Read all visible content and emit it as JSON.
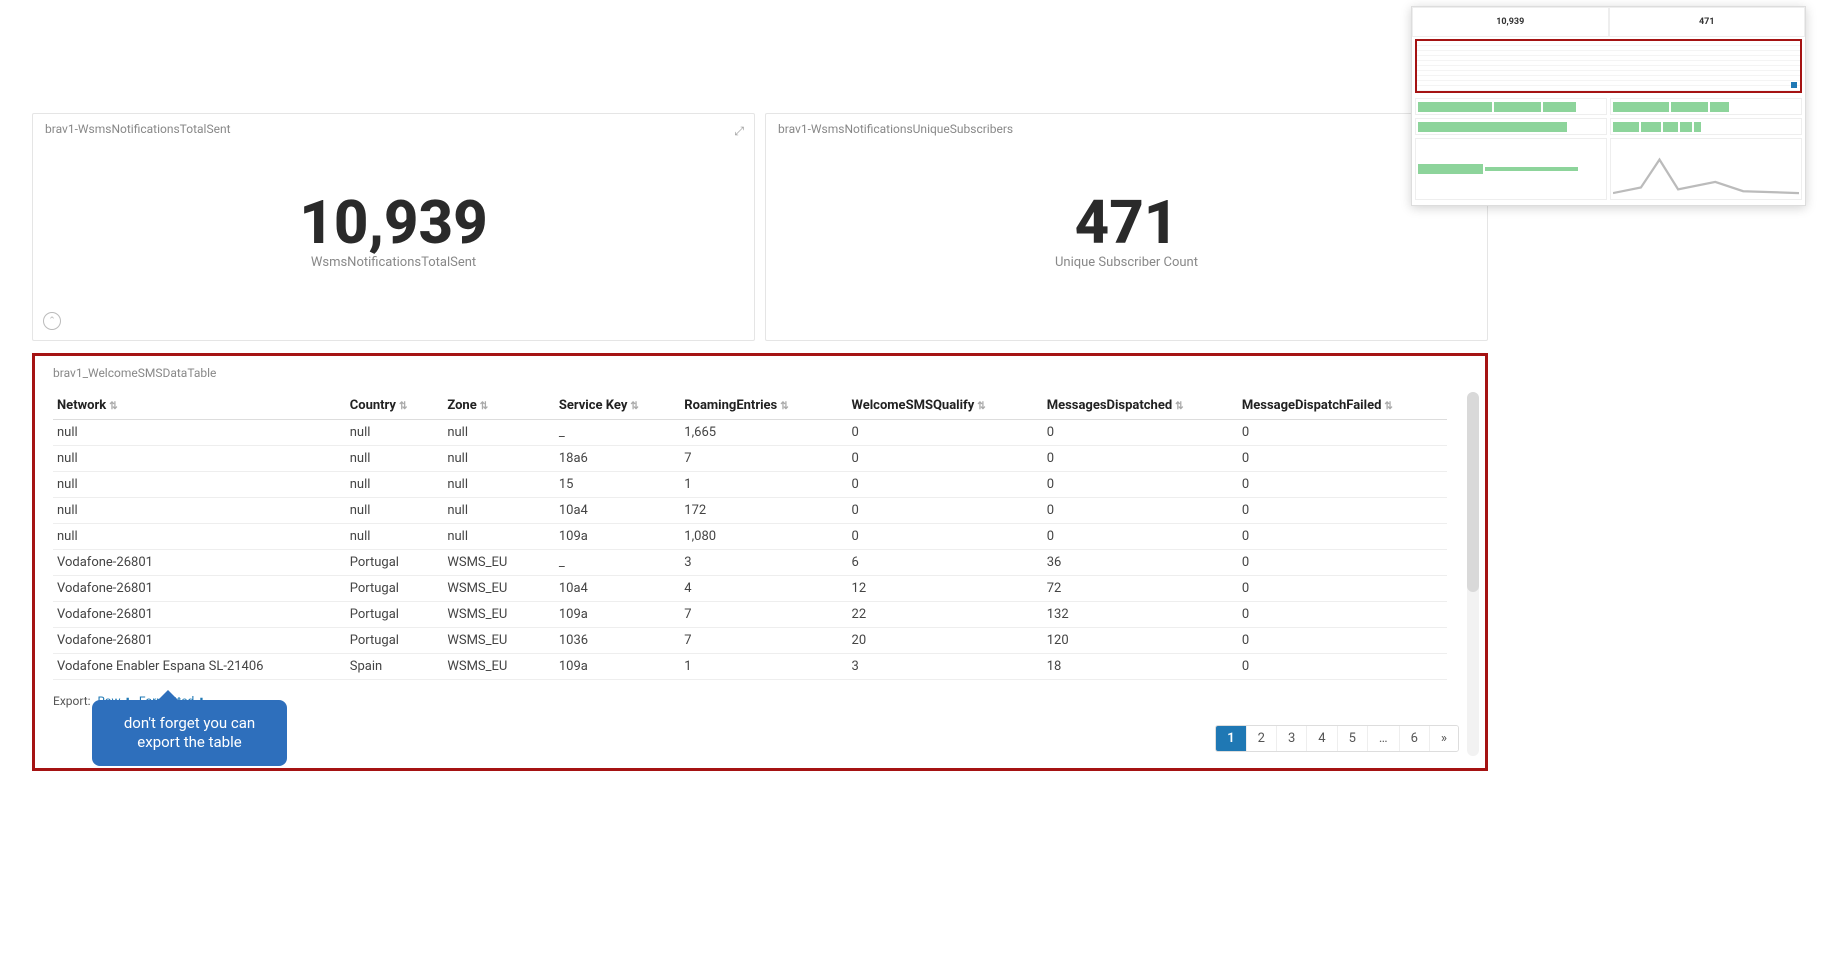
{
  "kpi": {
    "total_sent_card_title": "brav1-WsmsNotificationsTotalSent",
    "total_sent_value": "10,939",
    "total_sent_sub": "WsmsNotificationsTotalSent",
    "unique_card_title": "brav1-WsmsNotificationsUniqueSubscribers",
    "unique_value": "471",
    "unique_sub": "Unique Subscriber Count"
  },
  "minimap": {
    "kpi_left": "10,939",
    "kpi_right": "471"
  },
  "table": {
    "title": "brav1_WelcomeSMSDataTable",
    "columns": [
      "Network",
      "Country",
      "Zone",
      "Service Key",
      "RoamingEntries",
      "WelcomeSMSQualify",
      "MessagesDispatched",
      "MessageDispatchFailed"
    ],
    "rows": [
      [
        "null",
        "null",
        "null",
        "_",
        "1,665",
        "0",
        "0",
        "0"
      ],
      [
        "null",
        "null",
        "null",
        "18a6",
        "7",
        "0",
        "0",
        "0"
      ],
      [
        "null",
        "null",
        "null",
        "15",
        "1",
        "0",
        "0",
        "0"
      ],
      [
        "null",
        "null",
        "null",
        "10a4",
        "172",
        "0",
        "0",
        "0"
      ],
      [
        "null",
        "null",
        "null",
        "109a",
        "1,080",
        "0",
        "0",
        "0"
      ],
      [
        "Vodafone-26801",
        "Portugal",
        "WSMS_EU",
        "_",
        "3",
        "6",
        "36",
        "0"
      ],
      [
        "Vodafone-26801",
        "Portugal",
        "WSMS_EU",
        "10a4",
        "4",
        "12",
        "72",
        "0"
      ],
      [
        "Vodafone-26801",
        "Portugal",
        "WSMS_EU",
        "109a",
        "7",
        "22",
        "132",
        "0"
      ],
      [
        "Vodafone-26801",
        "Portugal",
        "WSMS_EU",
        "1036",
        "7",
        "20",
        "120",
        "0"
      ],
      [
        "Vodafone Enabler Espana SL-21406",
        "Spain",
        "WSMS_EU",
        "109a",
        "1",
        "3",
        "18",
        "0"
      ]
    ],
    "export_label": "Export:",
    "export_raw": "Raw",
    "export_formatted": "Formatted",
    "pages": [
      "1",
      "2",
      "3",
      "4",
      "5",
      "…",
      "6",
      "»"
    ],
    "active_page_index": 0
  },
  "callout_text": "don't forget you can export the table",
  "col_widths": [
    "21%",
    "7%",
    "8%",
    "9%",
    "12%",
    "14%",
    "14%",
    "15%"
  ]
}
